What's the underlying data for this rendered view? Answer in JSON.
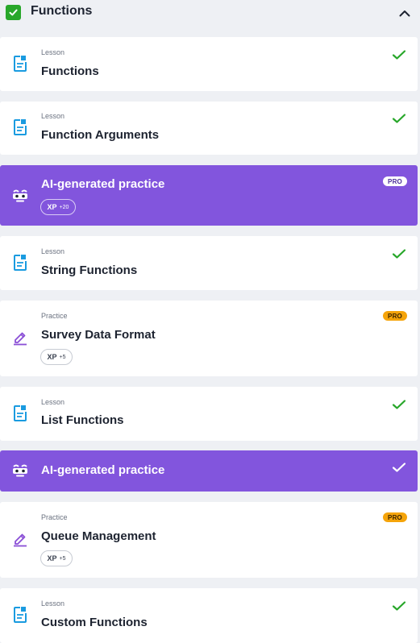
{
  "header": {
    "title": "Functions"
  },
  "colors": {
    "accent_purple": "#8255dd",
    "check_green": "#28a72a",
    "pro_orange": "#f5a40a",
    "lesson_icon_blue": "#1a9be0",
    "practice_icon_purple": "#8a4fd6"
  },
  "items": [
    {
      "kind": "Lesson",
      "name": "Functions",
      "icon": "lesson-doc-icon",
      "status": "completed"
    },
    {
      "kind": "Lesson",
      "name": "Function Arguments",
      "icon": "lesson-doc-icon",
      "status": "completed"
    },
    {
      "kind": "",
      "name": "AI-generated practice",
      "icon": "ai-face-icon",
      "badge": "PRO",
      "xp_label": "XP",
      "xp_value": "+20"
    },
    {
      "kind": "Lesson",
      "name": "String Functions",
      "icon": "lesson-doc-icon",
      "status": "completed"
    },
    {
      "kind": "Practice",
      "name": "Survey Data Format",
      "icon": "pencil-icon",
      "badge": "PRO",
      "xp_label": "XP",
      "xp_value": "+5"
    },
    {
      "kind": "Lesson",
      "name": "List Functions",
      "icon": "lesson-doc-icon",
      "status": "completed"
    },
    {
      "kind": "",
      "name": "AI-generated practice",
      "icon": "ai-face-icon",
      "status": "completed"
    },
    {
      "kind": "Practice",
      "name": "Queue Management",
      "icon": "pencil-icon",
      "badge": "PRO",
      "xp_label": "XP",
      "xp_value": "+5"
    },
    {
      "kind": "Lesson",
      "name": "Custom Functions",
      "icon": "lesson-doc-icon",
      "status": "completed"
    }
  ]
}
